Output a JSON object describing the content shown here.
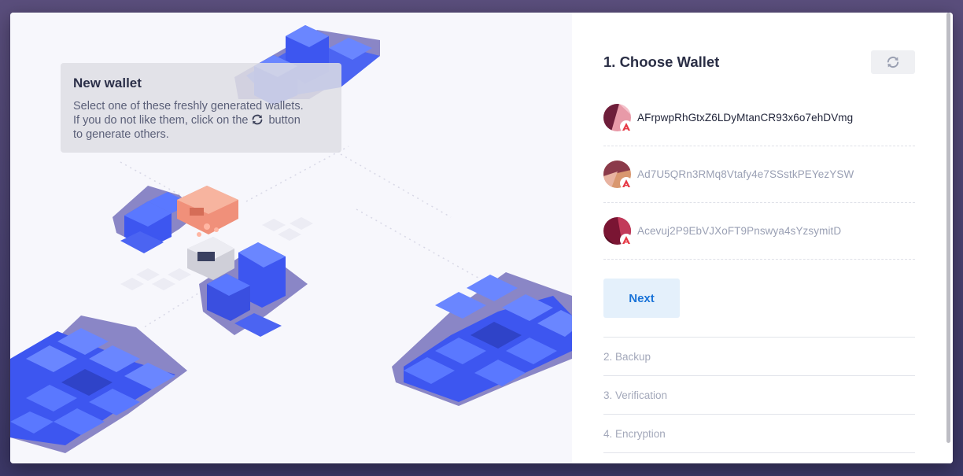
{
  "tooltip": {
    "title": "New wallet",
    "line1": "Select one of these freshly generated wallets.",
    "line2_before": "If you do not like them, click on the",
    "line2_after": "button",
    "line3": "to generate others."
  },
  "panel": {
    "step_title": "1. Choose Wallet",
    "refresh_icon": "refresh-icon",
    "wallets": [
      {
        "address": "AFrpwpRhGtxZ6LDyMtanCR93x6o7ehDVmg",
        "selected": true,
        "colors": [
          "#6e1e3a",
          "#e89aa8"
        ]
      },
      {
        "address": "Ad7U5QRn3RMq8Vtafy4e7SSstkPEYezYSW",
        "selected": false,
        "colors": [
          "#8b3a4a",
          "#d9976f"
        ]
      },
      {
        "address": "Acevuj2P9EbVJXoFT9Pnswya4sYzsymitD",
        "selected": false,
        "colors": [
          "#7a1533",
          "#c23a5a"
        ]
      }
    ],
    "next_label": "Next",
    "steps": [
      "2. Backup",
      "3. Verification",
      "4. Encryption"
    ]
  },
  "colors": {
    "accent": "#1a73d8",
    "cube_blue": "#3d56f0",
    "cube_top": "#5a78ff",
    "shadow_purple": "#8a86c6"
  }
}
